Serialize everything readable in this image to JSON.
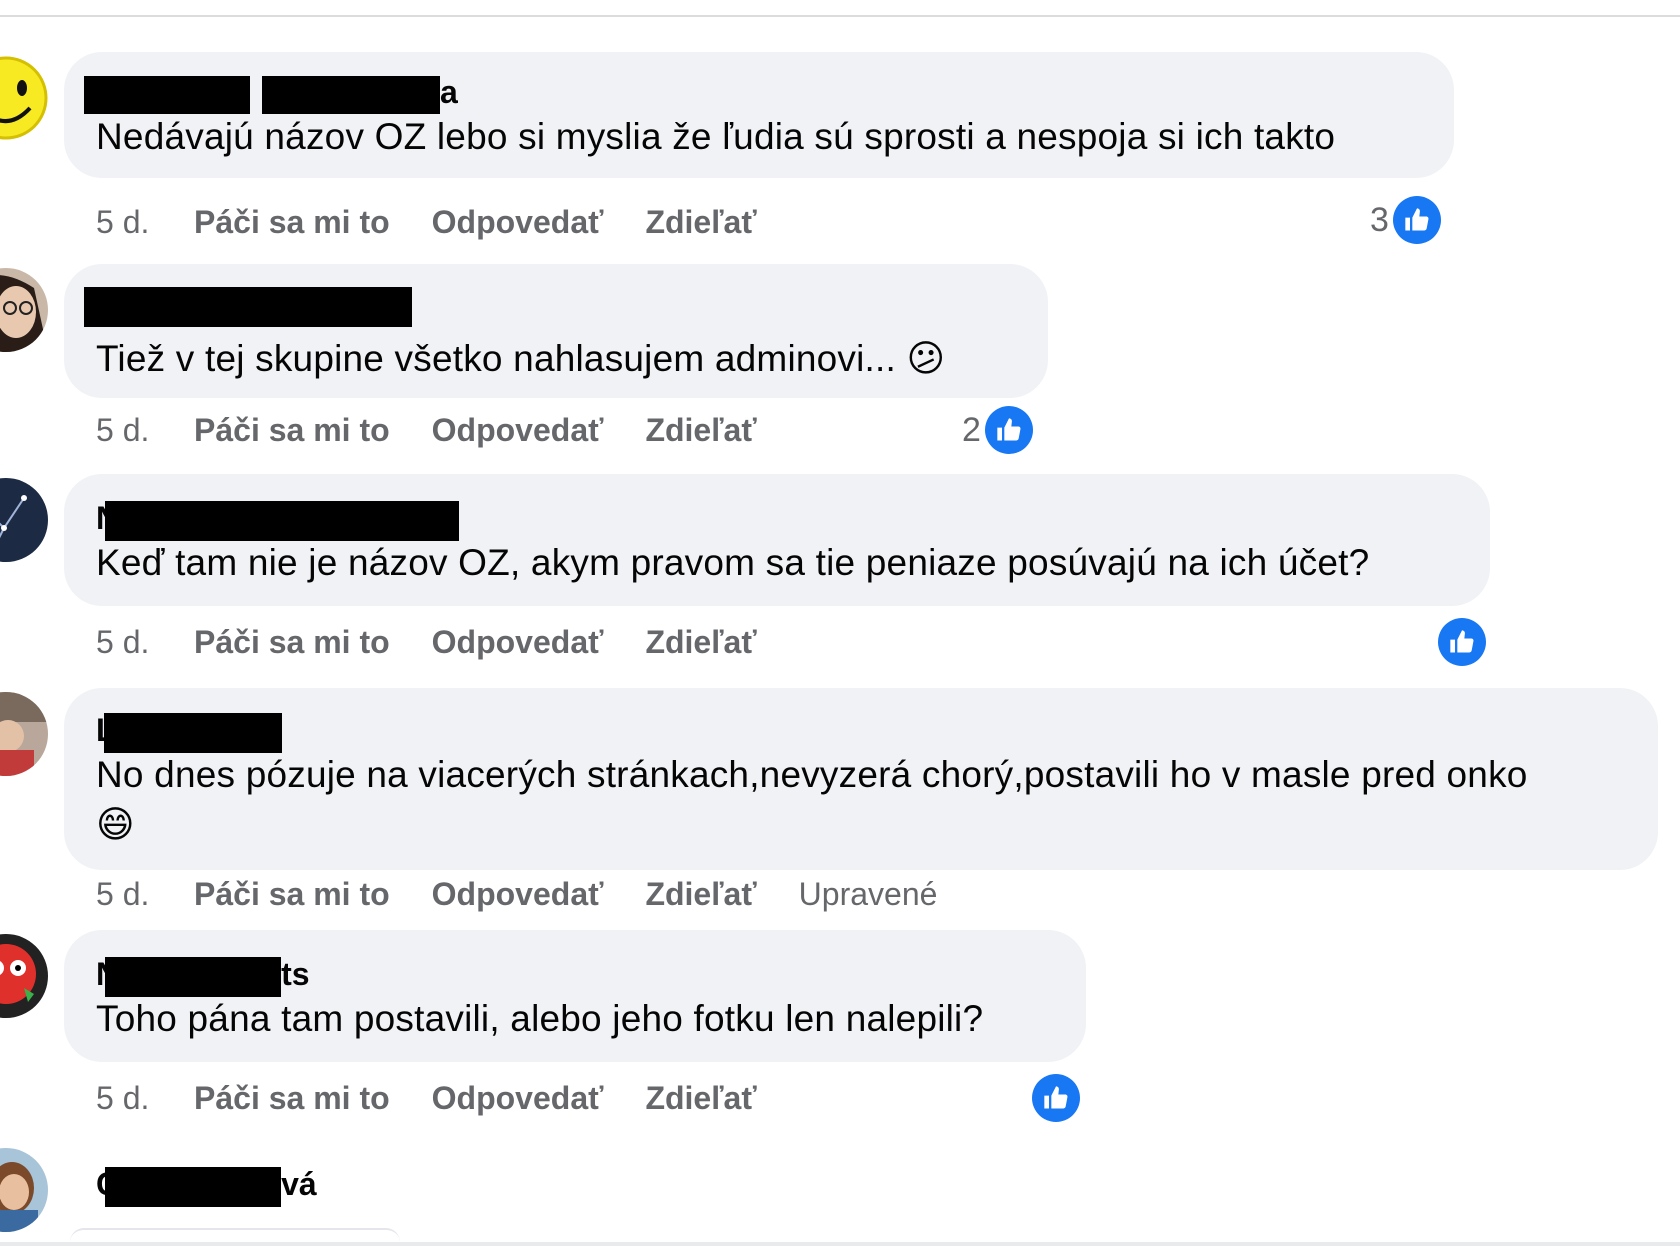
{
  "comments": [
    {
      "author_prefix": "",
      "author_suffix": "a",
      "text": "Nedávajú názov OZ lebo si myslia že ľudia sú sprosti a nespoja si ich takto",
      "time": "5 d.",
      "like_label": "Páči sa mi to",
      "reply_label": "Odpovedať",
      "share_label": "Zdieľať",
      "reaction_count": "3",
      "avatar": "smiley-avatar"
    },
    {
      "author_prefix": "",
      "author_suffix": "",
      "text": "Tiež v tej skupine všetko nahlasujem adminovi... 😕",
      "time": "5 d.",
      "like_label": "Páči sa mi to",
      "reply_label": "Odpovedať",
      "share_label": "Zdieľať",
      "reaction_count": "2",
      "avatar": "portrait-avatar"
    },
    {
      "author_prefix": "N",
      "author_suffix": "",
      "text": "Keď tam nie je názov OZ, akym pravom sa tie peniaze posúvajú na ich účet?",
      "time": "5 d.",
      "like_label": "Páči sa mi to",
      "reply_label": "Odpovedať",
      "share_label": "Zdieľať",
      "reaction_count": "",
      "avatar": "constellation-avatar"
    },
    {
      "author_prefix": "L",
      "author_suffix": "",
      "text": "No dnes pózuje na viacerých stránkach,nevyzerá chorý,postavili ho v masle pred onko😄",
      "time": "5 d.",
      "like_label": "Páči sa mi to",
      "reply_label": "Odpovedať",
      "share_label": "Zdieľať",
      "edited_label": "Upravené",
      "reaction_count": "",
      "avatar": "photo-avatar"
    },
    {
      "author_prefix": "N",
      "author_suffix": "ts",
      "text": "Toho pána tam postavili, alebo jeho fotku len nalepili?",
      "time": "5 d.",
      "like_label": "Páči sa mi to",
      "reply_label": "Odpovedať",
      "share_label": "Zdieľať",
      "reaction_count": "",
      "avatar": "cartoon-avatar"
    },
    {
      "author_prefix": "C",
      "author_suffix": "vá",
      "avatar": "woman-avatar"
    }
  ],
  "colors": {
    "bubble": "#f0f2f5",
    "meta_text": "#65676b",
    "like_blue": "#1877f2",
    "redaction": "#000000"
  },
  "icons": {
    "reaction": "like-icon"
  }
}
